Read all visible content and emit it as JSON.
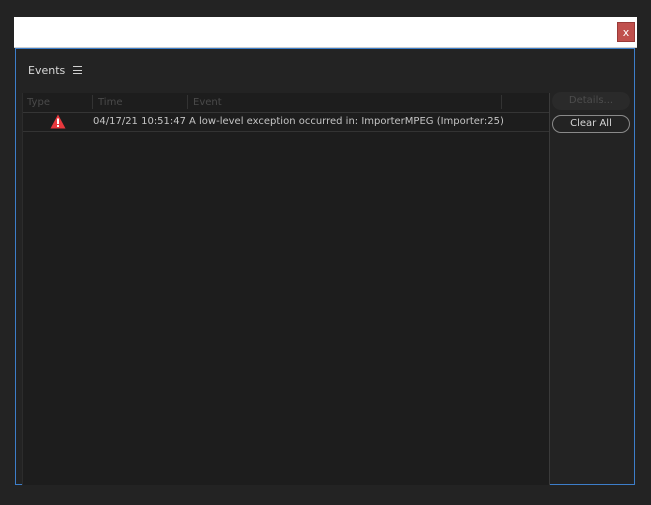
{
  "window": {
    "close_label": "x"
  },
  "panel": {
    "title": "Events"
  },
  "table": {
    "columns": [
      "Type",
      "Time",
      "Event"
    ],
    "rows": [
      {
        "type_icon": "warning-icon",
        "time": "04/17/21 10:51:47",
        "event": "A low-level exception occurred in: ImporterMPEG (Importer:25)"
      }
    ]
  },
  "buttons": {
    "details": "Details...",
    "clear_all": "Clear All"
  },
  "colors": {
    "accent_border": "#3d7ec9",
    "close_button": "#c0504d",
    "warning": "#e8383d"
  }
}
